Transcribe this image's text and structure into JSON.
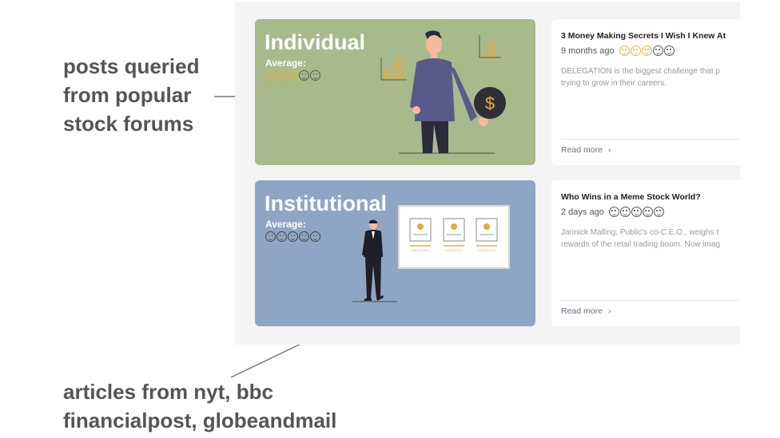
{
  "annotations": {
    "top": [
      "posts queried",
      "from popular",
      "stock forums"
    ],
    "bottom": [
      "articles from nyt,  bbc",
      "financialpost, globeandmail"
    ]
  },
  "categories": [
    {
      "title": "Individual",
      "avg_label": "Average:",
      "faces": [
        "gold",
        "gold",
        "gold",
        "gray",
        "gray"
      ],
      "color": "#a8b98c"
    },
    {
      "title": "Institutional",
      "avg_label": "Average:",
      "faces": [
        "white",
        "white",
        "white",
        "white",
        "white"
      ],
      "color": "#8ea6c3"
    }
  ],
  "articles": [
    {
      "title": "3 Money Making Secrets I Wish I Knew At",
      "time": "9 months ago",
      "faces": [
        "gold",
        "gold",
        "gold",
        "gray",
        "gray"
      ],
      "excerpt_lines": [
        "DELEGATION is the biggest challenge that p",
        "trying to grow in their careers."
      ],
      "read_more": "Read more"
    },
    {
      "title": "Who Wins in a Meme Stock World?",
      "time": "2 days ago",
      "faces": [
        "gray",
        "gray",
        "gray",
        "gray",
        "gray"
      ],
      "excerpt_lines": [
        "Jannick Malling, Public's co-C.E.O., weighs t",
        "rewards of the retail trading boom. Now imag"
      ],
      "read_more": "Read more"
    }
  ],
  "icons": {
    "dollar": "$",
    "chevron": "›"
  }
}
